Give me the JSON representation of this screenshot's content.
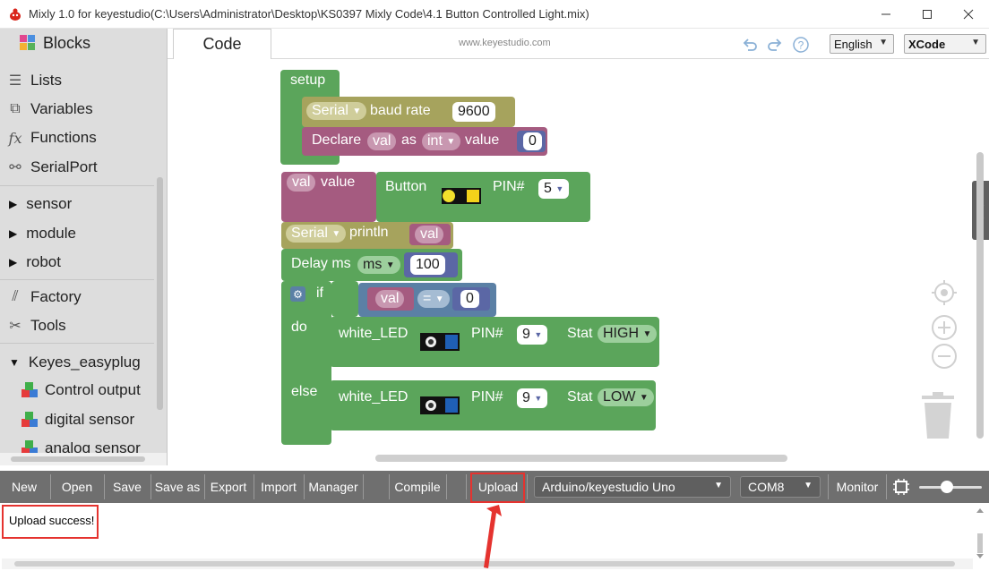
{
  "window": {
    "title": "Mixly 1.0 for keyestudio(C:\\Users\\Administrator\\Desktop\\KS0397 Mixly Code\\4.1 Button Controlled Light.mix)"
  },
  "sidebar": {
    "header": "Blocks",
    "items": [
      {
        "label": "Lists",
        "icon": "list-icon"
      },
      {
        "label": "Variables",
        "icon": "variables-icon"
      },
      {
        "label": "Functions",
        "icon": "function-icon"
      },
      {
        "label": "SerialPort",
        "icon": "serialport-icon"
      },
      {
        "label": "sensor",
        "icon": "triangle-right-icon"
      },
      {
        "label": "module",
        "icon": "triangle-right-icon"
      },
      {
        "label": "robot",
        "icon": "triangle-right-icon"
      },
      {
        "label": "Factory",
        "icon": "factory-icon"
      },
      {
        "label": "Tools",
        "icon": "tools-icon"
      },
      {
        "label": "Keyes_easyplug",
        "icon": "triangle-down-icon"
      },
      {
        "label": "Control output",
        "icon": "cube-icon"
      },
      {
        "label": "digital sensor",
        "icon": "cube-icon"
      },
      {
        "label": "analog sensor",
        "icon": "cube-icon"
      }
    ]
  },
  "header": {
    "tab_code": "Code",
    "site_url": "www.keyestudio.com",
    "language": "English",
    "ide": "XCode"
  },
  "blocks": {
    "setup": {
      "label": "setup",
      "serial": "Serial",
      "baud_rate_label": "baud rate",
      "baud_rate": "9600",
      "declare": "Declare",
      "var_name": "val",
      "as": "as",
      "type": "int",
      "value_label": "value",
      "init_value": "0"
    },
    "read": {
      "var": "val",
      "value_label": "value",
      "button_label": "Button",
      "pin_label": "PIN#",
      "pin": "5"
    },
    "println": {
      "serial": "Serial",
      "label": "println",
      "var": "val"
    },
    "delay": {
      "label": "Delay ms",
      "unit": "ms",
      "value": "100"
    },
    "if_block": {
      "if_label": "if",
      "var": "val",
      "op": "=",
      "compare": "0",
      "do_label": "do",
      "else_label": "else"
    },
    "led_do": {
      "label": "white_LED",
      "pin_label": "PIN#",
      "pin": "9",
      "stat_label": "Stat",
      "stat": "HIGH"
    },
    "led_else": {
      "label": "white_LED",
      "pin_label": "PIN#",
      "pin": "9",
      "stat_label": "Stat",
      "stat": "LOW"
    }
  },
  "toolbar": {
    "new": "New",
    "open": "Open",
    "save": "Save",
    "save_as": "Save as",
    "export": "Export",
    "import": "Import",
    "manager": "Manager",
    "compile": "Compile",
    "upload": "Upload",
    "board": "Arduino/keyestudio Uno",
    "port": "COM8",
    "monitor": "Monitor"
  },
  "console": {
    "message": "Upload success!"
  },
  "colors": {
    "loop_green": "#5ba55b",
    "serial_olive": "#a6a35d",
    "variable_pink": "#a55b80",
    "logic_blue": "#5b80a5",
    "highlight_red": "#e5332f",
    "toolbar_gray": "#6f6f6f",
    "sidebar_gray": "#dddddd"
  }
}
